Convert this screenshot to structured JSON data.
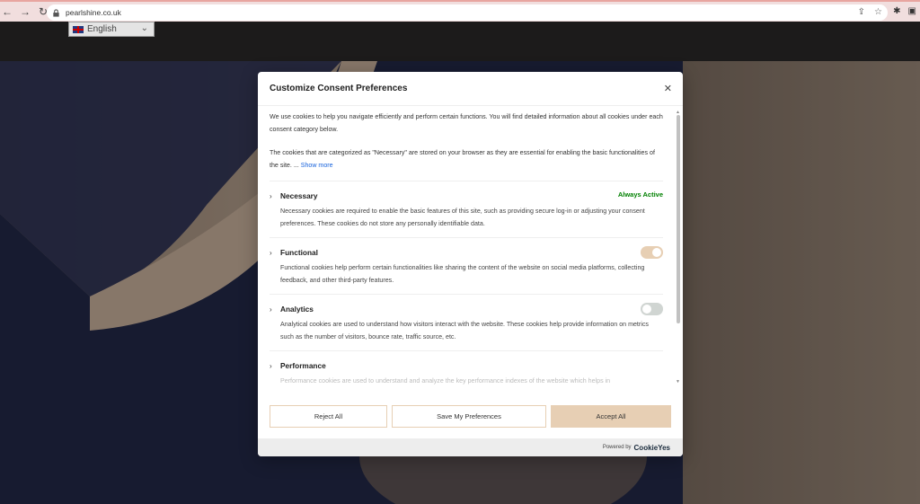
{
  "browser": {
    "url": "pearlshine.co.uk"
  },
  "site": {
    "language": "English"
  },
  "modal": {
    "title": "Customize Consent Preferences",
    "intro_p1": "We use cookies to help you navigate efficiently and perform certain functions. You will find detailed information about all cookies under each consent category below.",
    "intro_p2": "The cookies that are categorized as \"Necessary\" are stored on your browser as they are essential for enabling the basic functionalities of the site. ...",
    "show_more": "Show more",
    "categories": [
      {
        "name": "Necessary",
        "status": "Always Active",
        "description": "Necessary cookies are required to enable the basic features of this site, such as providing secure log-in or adjusting your consent preferences. These cookies do not store any personally identifiable data."
      },
      {
        "name": "Functional",
        "enabled": true,
        "description": "Functional cookies help perform certain functionalities like sharing the content of the website on social media platforms, collecting feedback, and other third-party features."
      },
      {
        "name": "Analytics",
        "enabled": false,
        "description": "Analytical cookies are used to understand how visitors interact with the website. These cookies help provide information on metrics such as the number of visitors, bounce rate, traffic source, etc."
      },
      {
        "name": "Performance",
        "description": "Performance cookies are used to understand and analyze the key performance indexes of the website which helps in"
      }
    ],
    "buttons": {
      "reject": "Reject All",
      "save": "Save My Preferences",
      "accept": "Accept All"
    },
    "footer": {
      "powered_by": "Powered by",
      "brand": "CookieYes"
    }
  },
  "colors": {
    "accent": "#e7cfb4",
    "always_active": "#008000",
    "link": "#1863dc"
  }
}
